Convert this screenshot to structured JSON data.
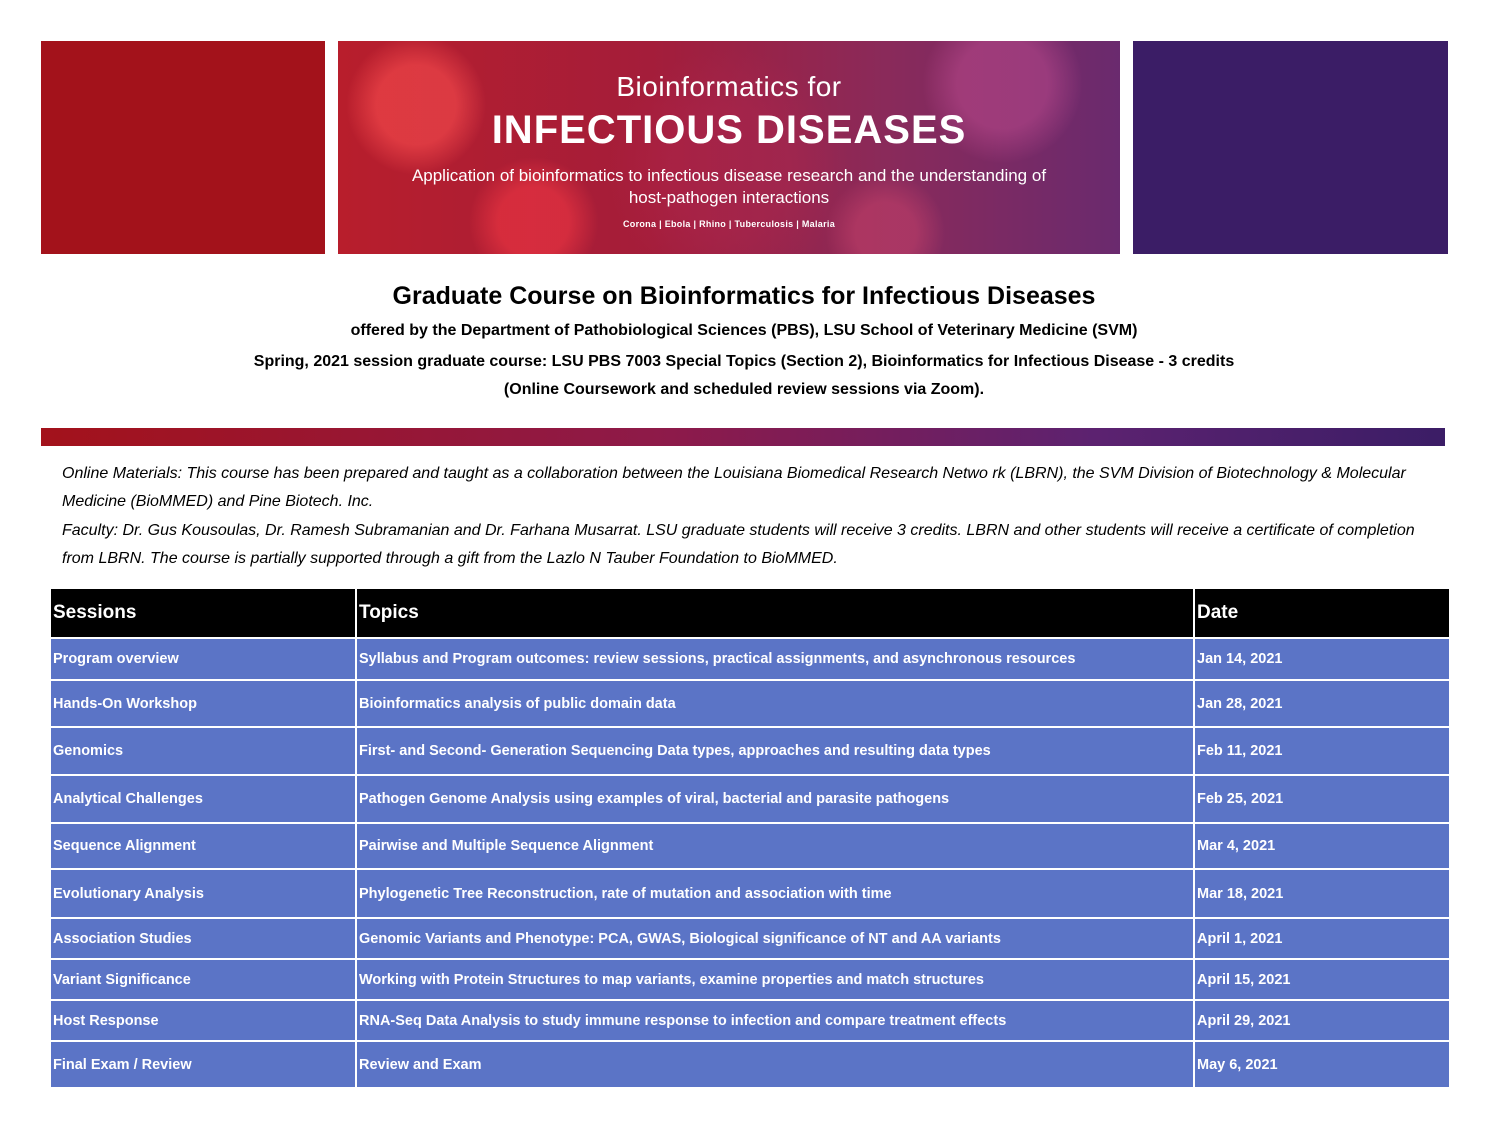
{
  "banner": {
    "small_title": "Bioinformatics for",
    "big_title": "INFECTIOUS DISEASES",
    "subtitle": "Application of bioinformatics to infectious disease research and the understanding of host-pathogen interactions",
    "tags": "Corona  |  Ebola  |  Rhino  |  Tuberculosis  |  Malaria"
  },
  "colors": {
    "red_panel": "#a3121b",
    "purple_panel": "#3b1d66",
    "table_header": "#000000",
    "table_row": "#5b74c6"
  },
  "heading": {
    "title": "Graduate Course on Bioinformatics for Infectious Diseases",
    "line1": "offered by the Department of Pathobiological Sciences (PBS), LSU School of Veterinary Medicine (SVM)",
    "line2": "Spring, 2021 session graduate course: LSU PBS 7003 Special Topics (Section 2), Bioinformatics for Infectious Disease - 3 credits",
    "line3": "(Online Coursework and scheduled review sessions via Zoom)."
  },
  "notes": {
    "online_materials": "Online Materials: This course has been prepared and taught as a collaboration between the Louisiana Biomedical Research Netwo rk (LBRN), the SVM Division of Biotechnology & Molecular Medicine (BioMMED) and Pine Biotech. Inc.",
    "faculty": "Faculty: Dr. Gus Kousoulas, Dr. Ramesh Subramanian and Dr. Farhana Musarrat. LSU graduate students will receive 3 credits. LBRN and other students will receive a certificate of completion from LBRN. The course is partially supported through a gift from the Lazlo N Tauber Foundation to BioMMED."
  },
  "table": {
    "headers": [
      "Sessions",
      "Topics",
      "Date"
    ],
    "rows": [
      {
        "session": "Program overview",
        "topic": "Syllabus and Program outcomes: review sessions, practical assignments, and asynchronous resources",
        "date": "Jan 14, 2021"
      },
      {
        "session": "Hands-On Workshop",
        "topic": "Bioinformatics analysis of public domain data",
        "date": "Jan 28, 2021"
      },
      {
        "session": "Genomics",
        "topic": "First- and Second- Generation Sequencing Data types, approaches and resulting data types",
        "date": "Feb 11, 2021"
      },
      {
        "session": "Analytical Challenges",
        "topic": "Pathogen Genome Analysis using examples of viral, bacterial and parasite pathogens",
        "date": "Feb 25, 2021"
      },
      {
        "session": "Sequence Alignment",
        "topic": "Pairwise and Multiple Sequence Alignment",
        "date": "Mar 4, 2021"
      },
      {
        "session": "Evolutionary Analysis",
        "topic": "Phylogenetic Tree Reconstruction, rate of mutation and association with time",
        "date": "Mar 18, 2021"
      },
      {
        "session": "Association Studies",
        "topic": "Genomic Variants and Phenotype: PCA, GWAS, Biological significance of NT and AA variants",
        "date": "April 1, 2021"
      },
      {
        "session": "Variant Significance",
        "topic": "Working with Protein Structures to map variants, examine properties and match structures",
        "date": "April 15, 2021"
      },
      {
        "session": "Host Response",
        "topic": "RNA-Seq Data Analysis to study immune response to infection and compare treatment effects",
        "date": "April 29, 2021"
      },
      {
        "session": "Final Exam / Review",
        "topic": "Review and Exam",
        "date": "May 6, 2021"
      }
    ]
  }
}
